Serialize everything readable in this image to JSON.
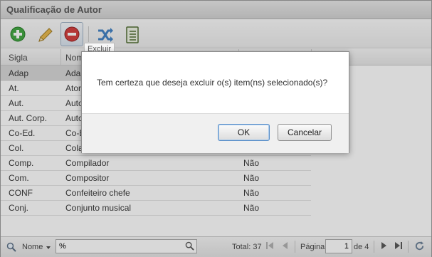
{
  "window": {
    "title": "Qualificação de Autor"
  },
  "toolbar": {
    "buttons": [
      {
        "icon": "add-icon"
      },
      {
        "icon": "pencil-icon"
      },
      {
        "icon": "delete-icon"
      },
      {
        "icon": "shuffle-icon"
      },
      {
        "icon": "notebook-icon"
      }
    ],
    "tooltip": "Excluir"
  },
  "grid": {
    "columns": [
      "Sigla",
      "Nome",
      ""
    ],
    "rows": [
      {
        "sigla": "Adap",
        "nome": "Ada",
        "flag": ""
      },
      {
        "sigla": "At.",
        "nome": "Ator",
        "flag": ""
      },
      {
        "sigla": "Aut.",
        "nome": "Auto",
        "flag": ""
      },
      {
        "sigla": "Aut. Corp.",
        "nome": "Auto",
        "flag": ""
      },
      {
        "sigla": "Co-Ed.",
        "nome": "Co-E",
        "flag": ""
      },
      {
        "sigla": "Col.",
        "nome": "Cola",
        "flag": ""
      },
      {
        "sigla": "Comp.",
        "nome": "Compilador",
        "flag": "Não"
      },
      {
        "sigla": "Com.",
        "nome": "Compositor",
        "flag": "Não"
      },
      {
        "sigla": "CONF",
        "nome": "Confeiteiro chefe",
        "flag": "Não"
      },
      {
        "sigla": "Conj.",
        "nome": "Conjunto musical",
        "flag": "Não"
      }
    ]
  },
  "status": {
    "filter_field": "Nome",
    "search_value": "%",
    "total_label": "Total: 37",
    "page_label": "Página",
    "page_value": "1",
    "of_label": "de 4"
  },
  "dialog": {
    "message": "Tem certeza que deseja excluir o(s) item(ns) selecionado(s)?",
    "ok_label": "OK",
    "cancel_label": "Cancelar"
  }
}
